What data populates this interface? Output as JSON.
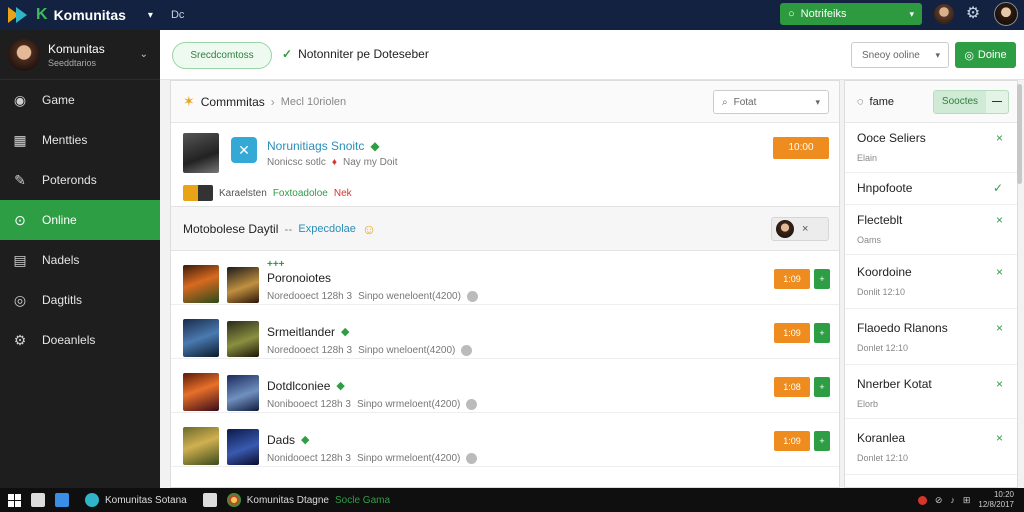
{
  "top": {
    "brand": "Komunitas",
    "brand_k": "K",
    "tag": "Dc",
    "online_btn": "Notrifeiks",
    "online_icon": "chat-icon"
  },
  "sidebar": {
    "profile": {
      "name": "Komunitas",
      "sub": "Seeddtarios"
    },
    "items": [
      {
        "label": "Game",
        "icon": "controller-icon",
        "active": false
      },
      {
        "label": "Mentties",
        "icon": "grid-icon",
        "active": false
      },
      {
        "label": "Poteronds",
        "icon": "pencil-icon",
        "active": false
      },
      {
        "label": "Online",
        "icon": "online-icon",
        "active": true
      },
      {
        "label": "Nadels",
        "icon": "list-icon",
        "active": false
      },
      {
        "label": "Dagtitls",
        "icon": "disc-icon",
        "active": false
      },
      {
        "label": "Doeanlels",
        "icon": "gear-icon",
        "active": false
      }
    ]
  },
  "header": {
    "pill": "Srecdcomtoss",
    "notice": "Notonniter pe Doteseber",
    "select": "Sneoy ooline",
    "done": "Doine"
  },
  "main": {
    "breadcrumb": {
      "root": "Commmitas",
      "current": "Mecl 10riolen"
    },
    "search": "Fotat",
    "featured": {
      "title": "Norunitiags Snoitc",
      "meta": "Nonicsc sotlc",
      "meta2": "Nay my Doit",
      "price": "10:00",
      "sub_a": "Karaelsten",
      "sub_b": "Foxtoadoloe",
      "sub_c": "Nek"
    },
    "section": {
      "title": "Motobolese Daytil",
      "dash": "--",
      "badge": "Expecdolae",
      "ctl": "×"
    },
    "rows": [
      {
        "name": "Poronoiotes",
        "plus": "+++",
        "meta": "Noredooect 128h 3",
        "meta2": "Sinpo weneloent(4200)",
        "price": "1:09",
        "btn": "+"
      },
      {
        "name": "Srmeitlander",
        "plus": "",
        "meta": "Noredooect 128h 3",
        "meta2": "Sinpo wneloent(4200)",
        "price": "1:09",
        "btn": "+"
      },
      {
        "name": "Dotdlconiee",
        "plus": "",
        "meta": "Nonibooect 128h 3",
        "meta2": "Sinpo wrmeloent(4200)",
        "price": "1:08",
        "btn": "+"
      },
      {
        "name": "Dads",
        "plus": "",
        "meta": "Nonidooect 128h 3",
        "meta2": "Sinpo wrmeloent(4200)",
        "price": "1:09",
        "btn": "+"
      }
    ]
  },
  "right": {
    "head": "fame",
    "toggle": "Sooctes",
    "toggle_min": "—",
    "items": [
      {
        "name": "Ooce Seliers",
        "sub": "Elain",
        "mark": "×"
      },
      {
        "name": "Hnpofoote",
        "sub": "",
        "mark": "✓"
      },
      {
        "name": "Flecteblt",
        "sub": "Oams",
        "mark": "×"
      },
      {
        "name": "Koordoine",
        "sub": "Donlit 12:10",
        "mark": "×"
      },
      {
        "name": "Flaoedo Rlanons",
        "sub": "Donlet 12:10",
        "mark": "×"
      },
      {
        "name": "Nnerber Kotat",
        "sub": "Elorb",
        "mark": "×"
      },
      {
        "name": "Koranlea",
        "sub": "Donlet 12:10",
        "mark": "×"
      }
    ]
  },
  "taskbar": {
    "app1": "Komunitas Sotana",
    "app2a": "Komunitas Dtagne",
    "app2b": "Socle Gama",
    "clock_time": "10:20",
    "clock_date": "12/8/2017"
  },
  "colors": {
    "accent": "#2e9e45",
    "topbar": "#132240",
    "sidebar": "#1e1e1e",
    "price": "#ef8c1f",
    "link": "#2a8fb8"
  }
}
